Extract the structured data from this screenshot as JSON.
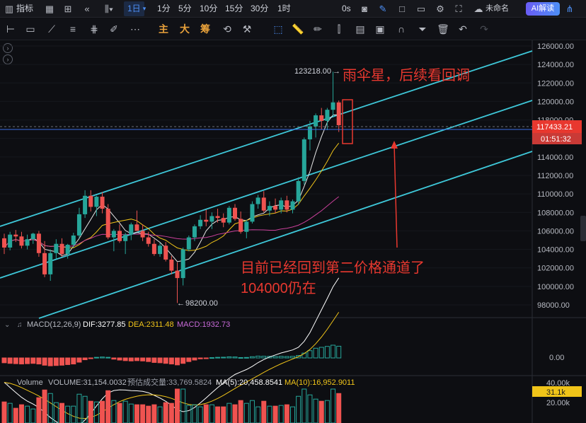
{
  "topbar": {
    "indicator_label": "指标",
    "timeframes": [
      "1日",
      "1分",
      "5分",
      "10分",
      "15分",
      "30分",
      "1时"
    ],
    "active_timeframe": "1日",
    "countdown_label": "0s",
    "layout_name": "未命名",
    "ai_button": "AI解读"
  },
  "drawing_toolbar": {
    "labels": [
      "主",
      "大",
      "筹"
    ]
  },
  "price_axis": {
    "ticks": [
      "126000.00",
      "124000.00",
      "122000.00",
      "120000.00",
      "118000.00",
      "116000.00",
      "114000.00",
      "112000.00",
      "110000.00",
      "108000.00",
      "106000.00",
      "104000.00",
      "102000.00",
      "100000.00",
      "98000.00"
    ],
    "current_price": "117433.21",
    "bar_countdown": "01:51:32",
    "macd_zero": "0.00",
    "volume_ticks": [
      "40.00k",
      "20.00k"
    ],
    "volume_current": "31.1k"
  },
  "annotations": {
    "high_label": "123218.00",
    "low_label": "98200.00",
    "note_top": "雨伞星，后续看回调",
    "note_middle_line1": "目前已经回到第二价格通道了",
    "note_middle_line2": "104000仍在"
  },
  "macd": {
    "title": "MACD(12,26,9)",
    "dif": "DIF:3277.85",
    "dea": "DEA:2311.48",
    "macd": "MACD:1932.73"
  },
  "volume": {
    "title": "Volume",
    "volume": "VOLUME:31,154.0032",
    "estimate": "预估成交量:33,769.5824",
    "ma5": "MA(5):20,458.8541",
    "ma10": "MA(10):16,952.9011"
  },
  "colors": {
    "up": "#26a69a",
    "down": "#ef5350",
    "channel": "#3ec7d8",
    "annotation": "#e8382f",
    "price_line": "#3a6ee8"
  },
  "chart_data": {
    "type": "candlestick",
    "ylim": [
      97000,
      127000
    ],
    "candles": [
      [
        105200,
        105700,
        103500,
        104200
      ],
      [
        104200,
        105900,
        103900,
        105600
      ],
      [
        105600,
        106100,
        104800,
        105400
      ],
      [
        105400,
        105900,
        104100,
        104400
      ],
      [
        104400,
        105600,
        104000,
        105100
      ],
      [
        105100,
        105800,
        104600,
        105700
      ],
      [
        105700,
        106000,
        103200,
        103600
      ],
      [
        103600,
        104900,
        101000,
        101300
      ],
      [
        101300,
        104000,
        100600,
        103600
      ],
      [
        103600,
        105100,
        103000,
        104600
      ],
      [
        104600,
        105200,
        103200,
        103500
      ],
      [
        103500,
        104600,
        103000,
        104500
      ],
      [
        104500,
        105800,
        104200,
        105500
      ],
      [
        105500,
        108500,
        105200,
        107800
      ],
      [
        107800,
        110400,
        107400,
        109800
      ],
      [
        109800,
        110400,
        108100,
        108600
      ],
      [
        108600,
        109800,
        107600,
        109700
      ],
      [
        109700,
        110200,
        107900,
        108400
      ],
      [
        108400,
        108900,
        105100,
        105300
      ],
      [
        105300,
        106200,
        103800,
        106000
      ],
      [
        106000,
        106700,
        104700,
        104900
      ],
      [
        104900,
        105800,
        103500,
        105600
      ],
      [
        105600,
        106900,
        105000,
        106700
      ],
      [
        106700,
        108200,
        106400,
        106000
      ],
      [
        106000,
        106700,
        104900,
        105300
      ],
      [
        105300,
        105900,
        104300,
        104600
      ],
      [
        104600,
        105100,
        103300,
        103500
      ],
      [
        103500,
        104700,
        103200,
        104400
      ],
      [
        104400,
        104800,
        102700,
        102900
      ],
      [
        102900,
        103300,
        101300,
        101700
      ],
      [
        101700,
        102600,
        98200,
        100900
      ],
      [
        100900,
        104200,
        100100,
        104000
      ],
      [
        104000,
        105500,
        103800,
        105300
      ],
      [
        105300,
        106700,
        104900,
        106500
      ],
      [
        106500,
        107700,
        106200,
        107200
      ],
      [
        107200,
        108300,
        106500,
        107000
      ],
      [
        107000,
        108000,
        106200,
        107600
      ],
      [
        107600,
        108400,
        106900,
        107400
      ],
      [
        107400,
        107900,
        106400,
        106900
      ],
      [
        106900,
        108700,
        106700,
        108500
      ],
      [
        108500,
        108900,
        107100,
        107300
      ],
      [
        107300,
        108100,
        105700,
        105900
      ],
      [
        105900,
        107200,
        105200,
        107000
      ],
      [
        107000,
        109200,
        106800,
        108900
      ],
      [
        108900,
        109900,
        108400,
        109600
      ],
      [
        109600,
        110300,
        108000,
        108200
      ],
      [
        108200,
        109200,
        107600,
        108700
      ],
      [
        108700,
        109500,
        107900,
        108300
      ],
      [
        108300,
        109600,
        107900,
        109300
      ],
      [
        109300,
        109800,
        108000,
        108300
      ],
      [
        108300,
        109400,
        107900,
        109200
      ],
      [
        109200,
        111800,
        108800,
        111400
      ],
      [
        111400,
        116100,
        111000,
        115900
      ],
      [
        115900,
        117900,
        114700,
        117300
      ],
      [
        117300,
        118700,
        116100,
        118500
      ],
      [
        118500,
        119300,
        117000,
        117900
      ],
      [
        117900,
        119300,
        116900,
        119100
      ],
      [
        119100,
        123218,
        118400,
        119900
      ],
      [
        119900,
        120100,
        116700,
        117433
      ]
    ],
    "price_line": 117433.21,
    "high": 123218.0,
    "low": 98200.0,
    "macd_histogram": [
      -800,
      -900,
      -950,
      -1000,
      -950,
      -900,
      -1000,
      -1200,
      -1300,
      -1250,
      -1200,
      -1100,
      -1000,
      -700,
      -300,
      -100,
      100,
      150,
      100,
      -200,
      -350,
      -450,
      -500,
      -450,
      -500,
      -600,
      -750,
      -800,
      -900,
      -1000,
      -1150,
      -900,
      -600,
      -350,
      -150,
      -50,
      50,
      100,
      120,
      180,
      160,
      60,
      80,
      200,
      300,
      280,
      260,
      240,
      260,
      230,
      260,
      400,
      800,
      1200,
      1600,
      1750,
      1900,
      2100,
      1932
    ]
  }
}
